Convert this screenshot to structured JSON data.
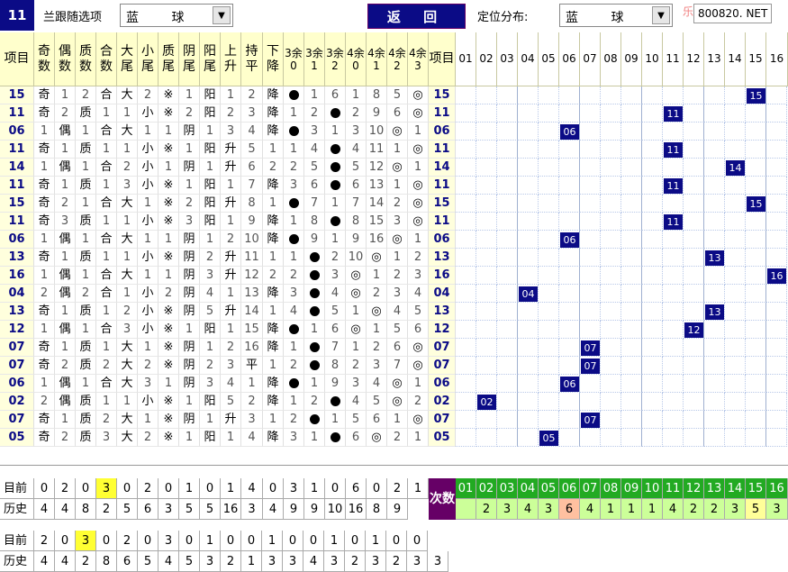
{
  "topbar": {
    "issue_tag": "11",
    "filter_label": "兰跟随选项",
    "filter_value": "蓝 球",
    "back_label": "返 回",
    "dist_label": "定位分布:",
    "dist_value": "蓝 球",
    "brand_text": "乐彩",
    "site_text": "800820. NET"
  },
  "headers": [
    "项目",
    "奇数",
    "偶数",
    "质数",
    "合数",
    "大尾",
    "小尾",
    "质尾",
    "阴尾",
    "阳尾",
    "上升",
    "持平",
    "下降",
    "3余0",
    "3余1",
    "3余2",
    "4余0",
    "4余1",
    "4余2",
    "4余3",
    "项目"
  ],
  "grid_columns": [
    "01",
    "02",
    "03",
    "04",
    "05",
    "06",
    "07",
    "08",
    "09",
    "10",
    "11",
    "12",
    "13",
    "14",
    "15",
    "16"
  ],
  "rows": [
    {
      "item": "15",
      "cells": [
        "奇",
        "1",
        "2",
        "合",
        "大",
        "2",
        "※",
        "1",
        "阳",
        "1",
        "2",
        "降",
        "●",
        "1",
        "6",
        "1",
        "8",
        "5",
        "◎",
        "15"
      ],
      "mark": "15"
    },
    {
      "item": "11",
      "cells": [
        "奇",
        "2",
        "质",
        "1",
        "1",
        "小",
        "※",
        "2",
        "阳",
        "2",
        "3",
        "降",
        "1",
        "2",
        "●",
        "2",
        "9",
        "6",
        "◎",
        "11"
      ],
      "mark": "11"
    },
    {
      "item": "06",
      "cells": [
        "1",
        "偶",
        "1",
        "合",
        "大",
        "1",
        "1",
        "阴",
        "1",
        "3",
        "4",
        "降",
        "●",
        "3",
        "1",
        "3",
        "10",
        "◎",
        "1",
        "06"
      ],
      "mark": "06"
    },
    {
      "item": "11",
      "cells": [
        "奇",
        "1",
        "质",
        "1",
        "1",
        "小",
        "※",
        "1",
        "阳",
        "升",
        "5",
        "1",
        "1",
        "4",
        "●",
        "4",
        "11",
        "1",
        "◎",
        "11"
      ],
      "mark": "11"
    },
    {
      "item": "14",
      "cells": [
        "1",
        "偶",
        "1",
        "合",
        "2",
        "小",
        "1",
        "阴",
        "1",
        "升",
        "6",
        "2",
        "2",
        "5",
        "●",
        "5",
        "12",
        "◎",
        "1",
        "14"
      ],
      "mark": "14"
    },
    {
      "item": "11",
      "cells": [
        "奇",
        "1",
        "质",
        "1",
        "3",
        "小",
        "※",
        "1",
        "阳",
        "1",
        "7",
        "降",
        "3",
        "6",
        "●",
        "6",
        "13",
        "1",
        "◎",
        "11"
      ],
      "mark": "11"
    },
    {
      "item": "15",
      "cells": [
        "奇",
        "2",
        "1",
        "合",
        "大",
        "1",
        "※",
        "2",
        "阳",
        "升",
        "8",
        "1",
        "●",
        "7",
        "1",
        "7",
        "14",
        "2",
        "◎",
        "15"
      ],
      "mark": "15"
    },
    {
      "item": "11",
      "cells": [
        "奇",
        "3",
        "质",
        "1",
        "1",
        "小",
        "※",
        "3",
        "阳",
        "1",
        "9",
        "降",
        "1",
        "8",
        "●",
        "8",
        "15",
        "3",
        "◎",
        "11"
      ],
      "mark": "11"
    },
    {
      "item": "06",
      "cells": [
        "1",
        "偶",
        "1",
        "合",
        "大",
        "1",
        "1",
        "阴",
        "1",
        "2",
        "10",
        "降",
        "●",
        "9",
        "1",
        "9",
        "16",
        "◎",
        "1",
        "06"
      ],
      "mark": "06"
    },
    {
      "item": "13",
      "cells": [
        "奇",
        "1",
        "质",
        "1",
        "1",
        "小",
        "※",
        "阴",
        "2",
        "升",
        "11",
        "1",
        "1",
        "●",
        "2",
        "10",
        "◎",
        "1",
        "2",
        "13"
      ],
      "mark": "13"
    },
    {
      "item": "16",
      "cells": [
        "1",
        "偶",
        "1",
        "合",
        "大",
        "1",
        "1",
        "阴",
        "3",
        "升",
        "12",
        "2",
        "2",
        "●",
        "3",
        "◎",
        "1",
        "2",
        "3",
        "16"
      ],
      "mark": "16"
    },
    {
      "item": "04",
      "cells": [
        "2",
        "偶",
        "2",
        "合",
        "1",
        "小",
        "2",
        "阴",
        "4",
        "1",
        "13",
        "降",
        "3",
        "●",
        "4",
        "◎",
        "2",
        "3",
        "4",
        "04"
      ],
      "mark": "04"
    },
    {
      "item": "13",
      "cells": [
        "奇",
        "1",
        "质",
        "1",
        "2",
        "小",
        "※",
        "阴",
        "5",
        "升",
        "14",
        "1",
        "4",
        "●",
        "5",
        "1",
        "◎",
        "4",
        "5",
        "13"
      ],
      "mark": "13"
    },
    {
      "item": "12",
      "cells": [
        "1",
        "偶",
        "1",
        "合",
        "3",
        "小",
        "※",
        "1",
        "阳",
        "1",
        "15",
        "降",
        "●",
        "1",
        "6",
        "◎",
        "1",
        "5",
        "6",
        "12"
      ],
      "mark": "12"
    },
    {
      "item": "07",
      "cells": [
        "奇",
        "1",
        "质",
        "1",
        "大",
        "1",
        "※",
        "阴",
        "1",
        "2",
        "16",
        "降",
        "1",
        "●",
        "7",
        "1",
        "2",
        "6",
        "◎",
        "07"
      ],
      "mark": "07"
    },
    {
      "item": "07",
      "cells": [
        "奇",
        "2",
        "质",
        "2",
        "大",
        "2",
        "※",
        "阴",
        "2",
        "3",
        "平",
        "1",
        "2",
        "●",
        "8",
        "2",
        "3",
        "7",
        "◎",
        "07"
      ],
      "mark": "07"
    },
    {
      "item": "06",
      "cells": [
        "1",
        "偶",
        "1",
        "合",
        "大",
        "3",
        "1",
        "阴",
        "3",
        "4",
        "1",
        "降",
        "●",
        "1",
        "9",
        "3",
        "4",
        "◎",
        "1",
        "06"
      ],
      "mark": "06"
    },
    {
      "item": "02",
      "cells": [
        "2",
        "偶",
        "质",
        "1",
        "1",
        "小",
        "※",
        "1",
        "阳",
        "5",
        "2",
        "降",
        "1",
        "2",
        "●",
        "4",
        "5",
        "◎",
        "2",
        "02"
      ],
      "mark": "02"
    },
    {
      "item": "07",
      "cells": [
        "奇",
        "1",
        "质",
        "2",
        "大",
        "1",
        "※",
        "阴",
        "1",
        "升",
        "3",
        "1",
        "2",
        "●",
        "1",
        "5",
        "6",
        "1",
        "◎",
        "07"
      ],
      "mark": "07"
    },
    {
      "item": "05",
      "cells": [
        "奇",
        "2",
        "质",
        "3",
        "大",
        "2",
        "※",
        "1",
        "阳",
        "1",
        "4",
        "降",
        "3",
        "1",
        "●",
        "6",
        "◎",
        "2",
        "1",
        "05"
      ],
      "mark": "05"
    }
  ],
  "summary1": {
    "now_label": "目前",
    "now": [
      "0",
      "2",
      "0",
      "3",
      "0",
      "2",
      "0",
      "1",
      "0",
      "1",
      "4",
      "0",
      "3",
      "1",
      "0",
      "6",
      "0",
      "2",
      "1"
    ],
    "hist_label": "历史",
    "hist": [
      "4",
      "4",
      "8",
      "2",
      "5",
      "6",
      "3",
      "5",
      "5",
      "16",
      "3",
      "4",
      "9",
      "9",
      "10",
      "16",
      "8",
      "9"
    ],
    "times_label": "次数",
    "times_cols": [
      "01",
      "02",
      "03",
      "04",
      "05",
      "06",
      "07",
      "08",
      "09",
      "10",
      "11",
      "12",
      "13",
      "14",
      "15",
      "16"
    ],
    "times": [
      "",
      "2",
      "3",
      "4",
      "3",
      "6",
      "4",
      "1",
      "1",
      "1",
      "4",
      "2",
      "2",
      "3",
      "5",
      "3"
    ]
  },
  "summary2": {
    "now_label": "目前",
    "now": [
      "2",
      "0",
      "3",
      "0",
      "2",
      "0",
      "3",
      "0",
      "1",
      "0",
      "0",
      "1",
      "0",
      "0",
      "1",
      "0",
      "1",
      "0",
      "0"
    ],
    "hist_label": "历史",
    "hist": [
      "4",
      "4",
      "2",
      "8",
      "6",
      "5",
      "4",
      "5",
      "3",
      "2",
      "1",
      "3",
      "3",
      "4",
      "3",
      "2",
      "3",
      "2",
      "3",
      "3"
    ]
  }
}
